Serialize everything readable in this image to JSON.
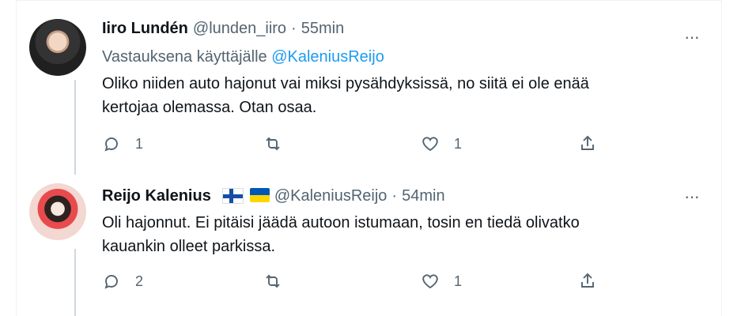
{
  "tweets": [
    {
      "author_name": "Iiro Lundén",
      "handle": "@lunden_iiro",
      "separator": "·",
      "time": "55min",
      "reply_prefix": "Vastauksena käyttäjälle",
      "reply_handle": "@KaleniusReijo",
      "text": "Oliko niiden auto hajonut vai miksi pysähdyksissä, no siitä ei ole enää\nkertojaa olemassa. Otan osaa.",
      "reply_count": "1",
      "retweet_count": "",
      "like_count": "1",
      "more_label": "···"
    },
    {
      "author_name": "Reijo Kalenius",
      "handle": "@KaleniusReijo",
      "separator": "·",
      "time": "54min",
      "text": "Oli hajonnut. Ei pitäisi jäädä autoon istumaan, tosin en tiedä olivatko\nkauankin olleet parkissa.",
      "reply_count": "2",
      "retweet_count": "",
      "like_count": "1",
      "more_label": "···"
    }
  ]
}
